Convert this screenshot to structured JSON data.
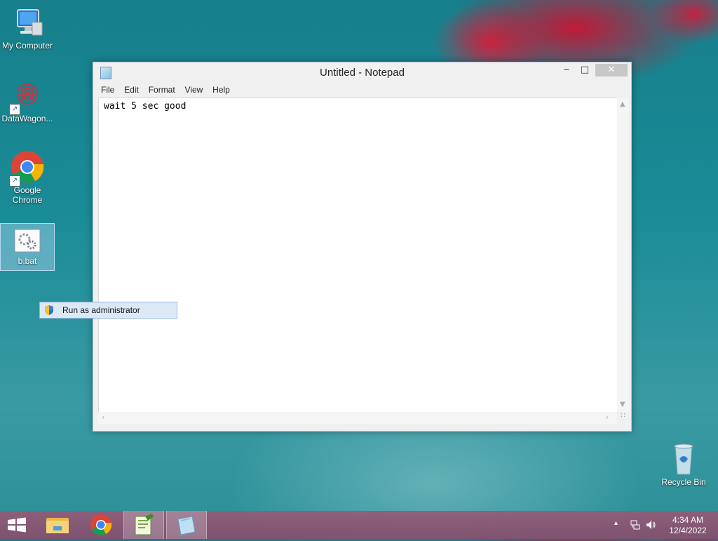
{
  "desktop": {
    "icons": [
      {
        "label": "My Computer"
      },
      {
        "label": "DataWagon..."
      },
      {
        "label": "Google Chrome"
      },
      {
        "label": "b.bat"
      },
      {
        "label": "Recycle Bin"
      }
    ]
  },
  "notepad": {
    "title": "Untitled - Notepad",
    "controls": {
      "minimize": "‒",
      "maximize": "□",
      "close": "✕"
    },
    "menu": [
      "File",
      "Edit",
      "Format",
      "View",
      "Help"
    ],
    "content": "wait 5 sec good"
  },
  "context_menu": {
    "items": [
      {
        "label": "Run as administrator",
        "icon": "uac-shield-icon"
      }
    ]
  },
  "taskbar": {
    "items": [
      {
        "name": "start",
        "icon": "windows-logo-icon"
      },
      {
        "name": "file-explorer",
        "icon": "folder-icon"
      },
      {
        "name": "google-chrome",
        "icon": "chrome-icon"
      },
      {
        "name": "notepad-plus-plus",
        "icon": "notepadpp-icon"
      },
      {
        "name": "notepad",
        "icon": "notepad-icon"
      }
    ],
    "tray": {
      "overflow": "▴",
      "time": "4:34 AM",
      "date": "12/4/2022"
    }
  },
  "colors": {
    "accent": "#1a8c97",
    "taskbar": "#8a5a78",
    "selection": "#dbe9f6"
  }
}
